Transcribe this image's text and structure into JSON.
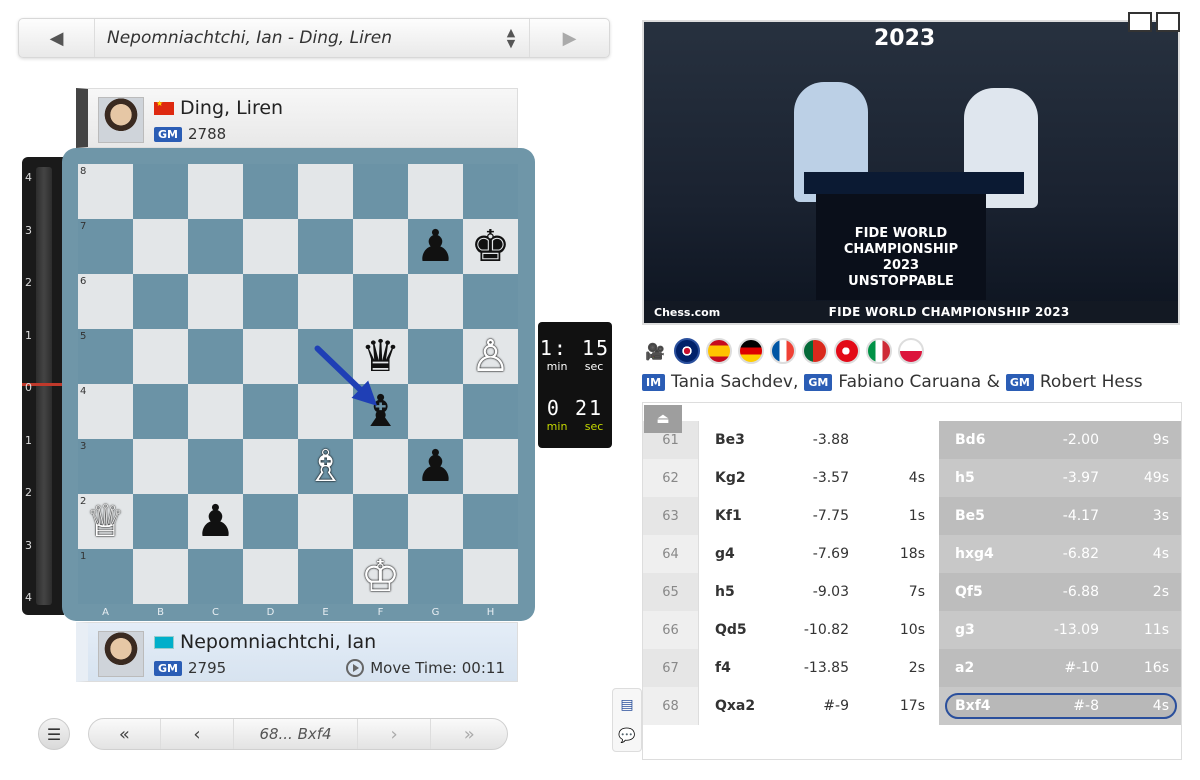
{
  "game_selector": {
    "title": "Nepomniachtchi, Ian - Ding, Liren",
    "prev_icon": "arrow-left",
    "next_icon": "arrow-right"
  },
  "top_player": {
    "name": "Ding, Liren",
    "title": "GM",
    "rating": "2788",
    "flag": "china"
  },
  "bottom_player": {
    "name": "Nepomniachtchi, Ian",
    "title": "GM",
    "rating": "2795",
    "flag": "kazakhstan",
    "move_time": "Move Time: 00:11"
  },
  "eval_ticks": [
    "4",
    "3",
    "2",
    "1",
    "0",
    "1",
    "2",
    "3",
    "4"
  ],
  "clocks": [
    {
      "digits": "1: 15",
      "unit_min": "min",
      "unit_sec": "sec"
    },
    {
      "digits": "0 21",
      "unit_min": "min",
      "unit_sec": "sec"
    }
  ],
  "board": {
    "files": [
      "A",
      "B",
      "C",
      "D",
      "E",
      "F",
      "G",
      "H"
    ],
    "ranks": [
      "8",
      "7",
      "6",
      "5",
      "4",
      "3",
      "2",
      "1"
    ],
    "pieces": [
      {
        "sq": "g7",
        "glyph": "♟",
        "color": "b",
        "name": "black-pawn-g7"
      },
      {
        "sq": "h7",
        "glyph": "♚",
        "color": "b",
        "name": "black-king-h7"
      },
      {
        "sq": "f5",
        "glyph": "♛",
        "color": "b",
        "name": "black-queen-f5"
      },
      {
        "sq": "h5",
        "glyph": "♙",
        "color": "w",
        "name": "white-pawn-h5"
      },
      {
        "sq": "f4",
        "glyph": "♝",
        "color": "b",
        "name": "black-bishop-f4"
      },
      {
        "sq": "e3",
        "glyph": "♗",
        "color": "w",
        "name": "white-bishop-e3"
      },
      {
        "sq": "g3",
        "glyph": "♟",
        "color": "b",
        "name": "black-pawn-g3"
      },
      {
        "sq": "a2",
        "glyph": "♕",
        "color": "w",
        "name": "white-queen-a2"
      },
      {
        "sq": "c2",
        "glyph": "♟",
        "color": "b",
        "name": "black-pawn-c2"
      },
      {
        "sq": "f1",
        "glyph": "♔",
        "color": "w",
        "name": "white-king-f1"
      }
    ],
    "last_move": {
      "from": "e5",
      "to": "f4"
    }
  },
  "nav": {
    "current": "68... Bxf4"
  },
  "video": {
    "year": "2023",
    "podium": "FIDE WORLD\nCHAMPIONSHIP\n2023\nUNSTOPPABLE",
    "brand": "Chess.com",
    "band_title": "FIDE WORLD CHAMPIONSHIP 2023"
  },
  "commentary": {
    "langs": [
      "uk",
      "es",
      "de",
      "fr",
      "pt",
      "tr",
      "it",
      "pl"
    ],
    "t1": "IM",
    "c1": "Tania Sachdev,",
    "t2": "GM",
    "c2": "Fabiano Caruana &",
    "t3": "GM",
    "c3": "Robert Hess"
  },
  "moves": [
    {
      "num": "61",
      "w": "Be3",
      "we": "-3.88",
      "wt": "",
      "b": "Bd6",
      "be": "-2.00",
      "bt": "9s"
    },
    {
      "num": "62",
      "w": "Kg2",
      "we": "-3.57",
      "wt": "4s",
      "b": "h5",
      "be": "-3.97",
      "bt": "49s"
    },
    {
      "num": "63",
      "w": "Kf1",
      "we": "-7.75",
      "wt": "1s",
      "b": "Be5",
      "be": "-4.17",
      "bt": "3s"
    },
    {
      "num": "64",
      "w": "g4",
      "we": "-7.69",
      "wt": "18s",
      "b": "hxg4",
      "be": "-6.82",
      "bt": "4s"
    },
    {
      "num": "65",
      "w": "h5",
      "we": "-9.03",
      "wt": "7s",
      "b": "Qf5",
      "be": "-6.88",
      "bt": "2s"
    },
    {
      "num": "66",
      "w": "Qd5",
      "we": "-10.82",
      "wt": "10s",
      "b": "g3",
      "be": "-13.09",
      "bt": "11s"
    },
    {
      "num": "67",
      "w": "f4",
      "we": "-13.85",
      "wt": "2s",
      "b": "a2",
      "be": "#-10",
      "bt": "16s"
    },
    {
      "num": "68",
      "w": "Qxa2",
      "we": "#-9",
      "wt": "17s",
      "b": "Bxf4",
      "be": "#-8",
      "bt": "4s"
    }
  ],
  "colors": {
    "board_dark": "#6b93a6",
    "board_light": "#e3e6e8",
    "accent": "#2a4f9c",
    "title_badge": "#2b5db5"
  }
}
